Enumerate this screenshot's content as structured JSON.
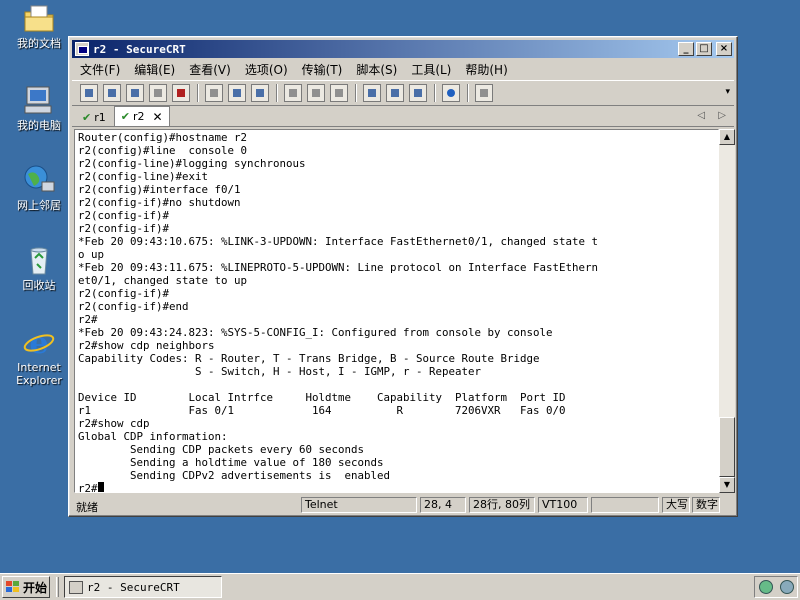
{
  "desktop": {
    "icons": [
      {
        "label": "我的文档",
        "icon": "folder-icon"
      },
      {
        "label": "我的电脑",
        "icon": "computer-icon"
      },
      {
        "label": "网上邻居",
        "icon": "network-icon"
      },
      {
        "label": "回收站",
        "icon": "recycle-bin-icon"
      },
      {
        "label": "Internet Explorer",
        "icon": "ie-icon"
      }
    ]
  },
  "window": {
    "title": "r2 - SecureCRT",
    "menus": [
      "文件(F)",
      "编辑(E)",
      "查看(V)",
      "选项(O)",
      "传输(T)",
      "脚本(S)",
      "工具(L)",
      "帮助(H)"
    ],
    "tabs": [
      {
        "label": "r1",
        "active": false
      },
      {
        "label": "r2",
        "active": true
      }
    ],
    "terminal_lines": [
      "Router(config)#hostname r2",
      "r2(config)#line  console 0",
      "r2(config-line)#logging synchronous",
      "r2(config-line)#exit",
      "r2(config)#interface f0/1",
      "r2(config-if)#no shutdown",
      "r2(config-if)#",
      "r2(config-if)#",
      "*Feb 20 09:43:10.675: %LINK-3-UPDOWN: Interface FastEthernet0/1, changed state t",
      "o up",
      "*Feb 20 09:43:11.675: %LINEPROTO-5-UPDOWN: Line protocol on Interface FastEthern",
      "et0/1, changed state to up",
      "r2(config-if)#",
      "r2(config-if)#end",
      "r2#",
      "*Feb 20 09:43:24.823: %SYS-5-CONFIG_I: Configured from console by console",
      "r2#show cdp neighbors",
      "Capability Codes: R - Router, T - Trans Bridge, B - Source Route Bridge",
      "                  S - Switch, H - Host, I - IGMP, r - Repeater",
      "",
      "Device ID        Local Intrfce     Holdtme    Capability  Platform  Port ID",
      "r1               Fas 0/1            164          R        7206VXR   Fas 0/0",
      "r2#show cdp",
      "Global CDP information:",
      "        Sending CDP packets every 60 seconds",
      "        Sending a holdtime value of 180 seconds",
      "        Sending CDPv2 advertisements is  enabled"
    ],
    "prompt": "r2#",
    "status": {
      "ready": "就绪",
      "protocol": "Telnet",
      "cursor_pos": "28,  4",
      "size": "28行, 80列",
      "emulation": "VT100",
      "caps": "大写",
      "num": "数字"
    }
  },
  "taskbar": {
    "start_label": "开始",
    "task_label": "r2 - SecureCRT"
  }
}
